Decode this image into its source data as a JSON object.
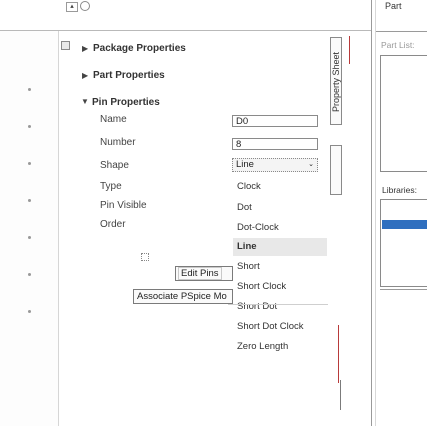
{
  "right_panel": {
    "part_title": "Part",
    "part_list_label": "Part List:",
    "libraries_label": "Libraries:"
  },
  "vertical_tab": {
    "label": "Property Sheet"
  },
  "tree": {
    "package_properties": "Package Properties",
    "part_properties": "Part Properties",
    "pin_properties": "Pin Properties"
  },
  "pin_properties": [
    {
      "label": "Name",
      "value": "D0"
    },
    {
      "label": "Number",
      "value": "8"
    },
    {
      "label": "Shape",
      "value": "Line"
    },
    {
      "label": "Type",
      "value": ""
    },
    {
      "label": "Pin Visible",
      "value": ""
    },
    {
      "label": "Order",
      "value": ""
    }
  ],
  "shape_dropdown": {
    "options": [
      "Clock",
      "Dot",
      "Dot-Clock",
      "Line",
      "Short",
      "Short Clock",
      "Short Dot",
      "Short Dot Clock",
      "Zero Length"
    ],
    "selected": "Line"
  },
  "buttons": {
    "edit_pins": "Edit Pins",
    "associate_pspice": "Associate PSpice Mo"
  },
  "colors": {
    "selection_blue": "#2f6fbf",
    "dropdown_highlight": "#e8e8e8",
    "red_marker": "#b83a3a"
  }
}
